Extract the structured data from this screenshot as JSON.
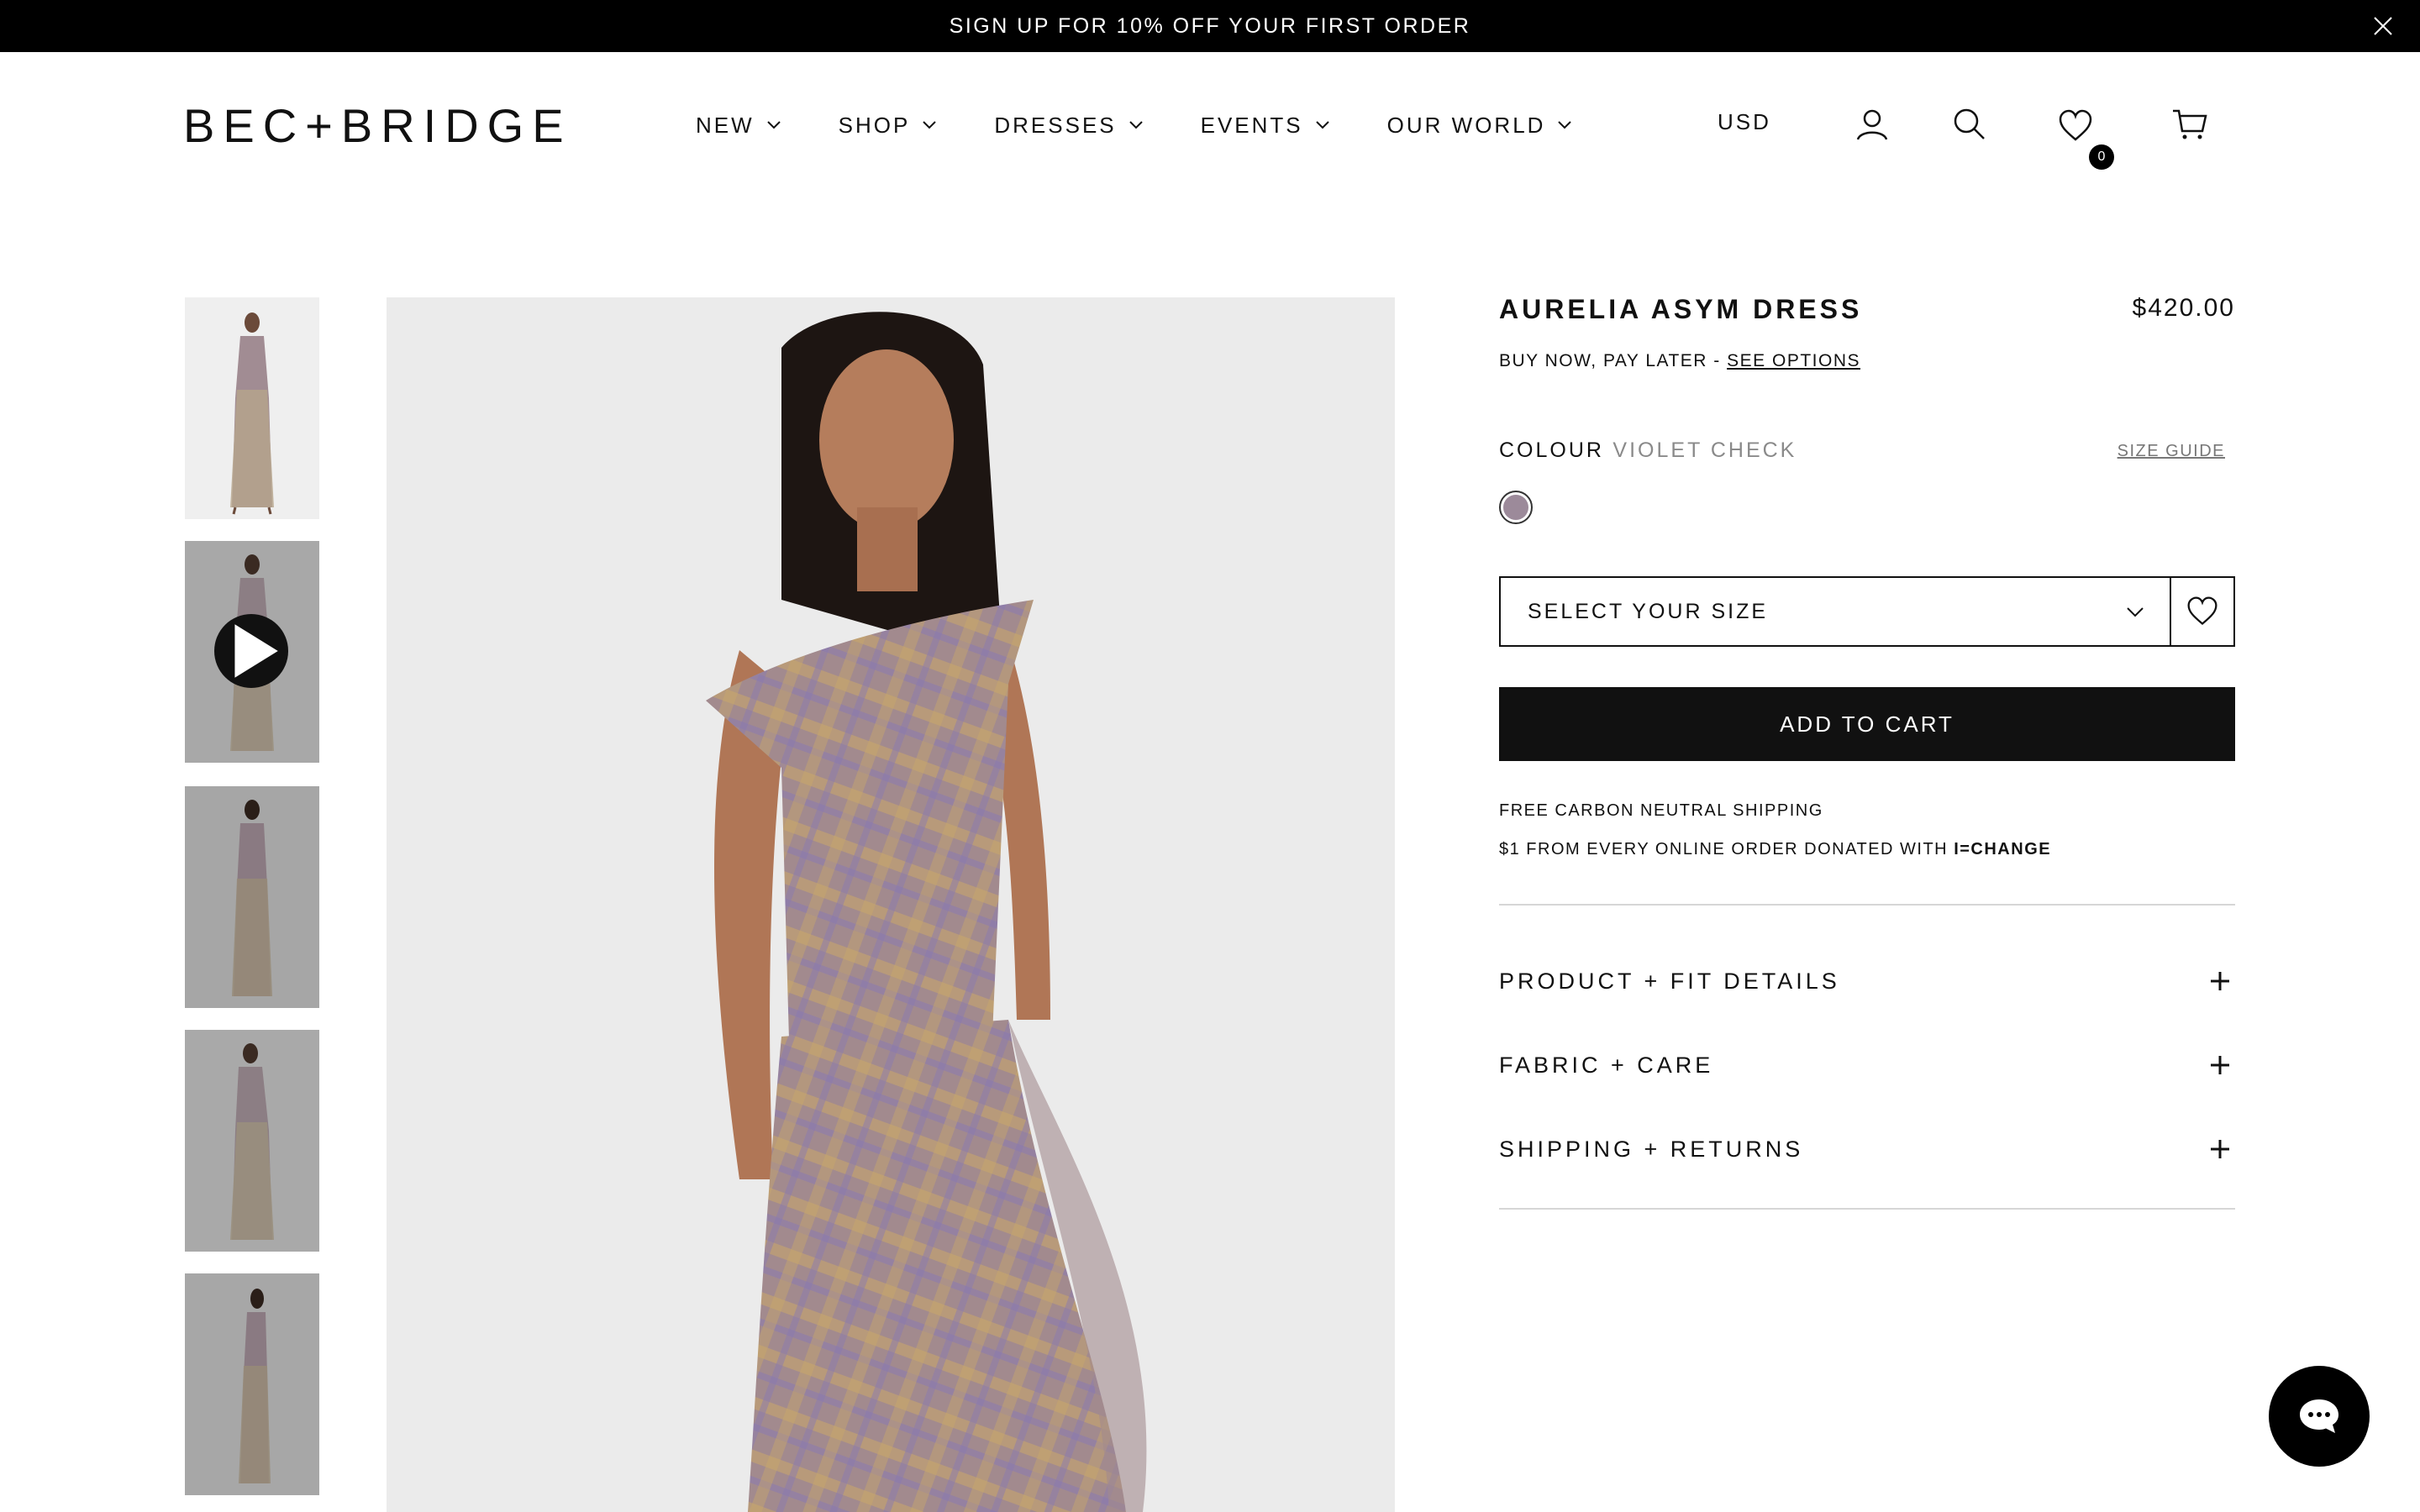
{
  "announcement": {
    "text": "SIGN UP FOR 10% OFF YOUR FIRST ORDER",
    "close_icon": "close-icon"
  },
  "header": {
    "logo": "BEC+BRIDGE",
    "nav": [
      {
        "label": "NEW"
      },
      {
        "label": "SHOP"
      },
      {
        "label": "DRESSES"
      },
      {
        "label": "EVENTS"
      },
      {
        "label": "OUR WORLD"
      }
    ],
    "currency": "USD",
    "icons": [
      "account-icon",
      "search-icon",
      "heart-icon",
      "cart-icon"
    ],
    "wishlist_count": "0"
  },
  "gallery": {
    "thumbnails": [
      "thumbnail-1",
      "thumbnail-2-video",
      "thumbnail-3",
      "thumbnail-4",
      "thumbnail-5"
    ],
    "play_icon": "play-icon"
  },
  "product": {
    "title": "AURELIA ASYM DRESS",
    "price": "$420.00",
    "bnpl_prefix": "BUY NOW, PAY LATER - ",
    "bnpl_link": "SEE OPTIONS",
    "colour_label": "COLOUR",
    "colour_value": "VIOLET CHECK",
    "size_guide": "SIZE GUIDE",
    "swatch_color": "#9c8a9a",
    "size_select": "SELECT YOUR SIZE",
    "add_to_cart": "ADD TO CART",
    "shipping_note": "FREE CARBON NEUTRAL SHIPPING",
    "donation_prefix": "$1 FROM EVERY ONLINE ORDER DONATED WITH ",
    "donation_brand": "i=CHANGE",
    "accordions": [
      {
        "label": "PRODUCT + FIT DETAILS"
      },
      {
        "label": "FABRIC + CARE"
      },
      {
        "label": "SHIPPING + RETURNS"
      }
    ]
  },
  "chat": {
    "icon": "chat-icon"
  },
  "colors": {
    "black": "#000000",
    "panel_bg": "#ebebeb",
    "divider": "#d6d6d6",
    "muted_text": "#8a8a8a"
  }
}
